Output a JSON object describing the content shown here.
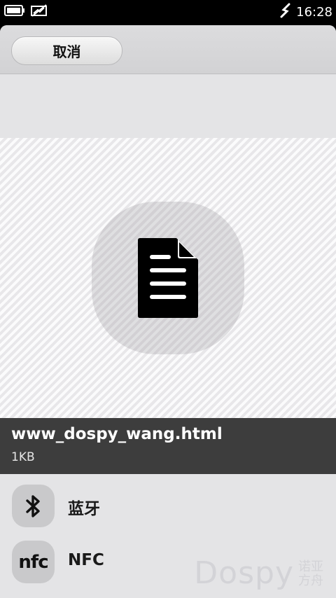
{
  "status_bar": {
    "time": "16:28",
    "icons": [
      "battery-icon",
      "no-signal-icon",
      "usb-icon"
    ]
  },
  "toolbar": {
    "cancel_label": "取消"
  },
  "file": {
    "icon": "document-icon",
    "name": "www_dospy_wang.html",
    "size": "1KB"
  },
  "share_options": [
    {
      "label": "蓝牙",
      "icon": "bluetooth-icon"
    },
    {
      "label": "NFC",
      "icon": "nfc-icon",
      "glyph": "nfc"
    }
  ],
  "watermark": {
    "main": "Dospy",
    "side": "诺亚方舟"
  }
}
